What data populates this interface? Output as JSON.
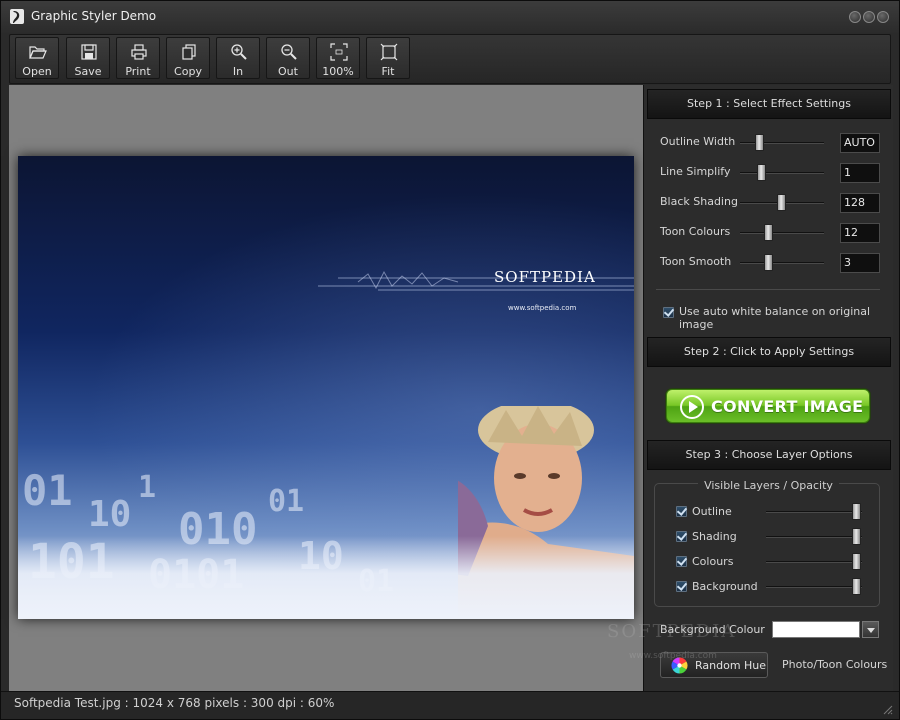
{
  "window": {
    "title": "Graphic Styler Demo"
  },
  "toolbar": {
    "buttons": [
      {
        "label": "Open",
        "icon": "folder-open-icon"
      },
      {
        "label": "Save",
        "icon": "floppy-disk-icon"
      },
      {
        "label": "Print",
        "icon": "printer-icon"
      },
      {
        "label": "Copy",
        "icon": "copy-icon"
      },
      {
        "label": "In",
        "icon": "zoom-in-icon"
      },
      {
        "label": "Out",
        "icon": "zoom-out-icon"
      },
      {
        "label": "100%",
        "icon": "actual-size-icon"
      },
      {
        "label": "Fit",
        "icon": "fit-window-icon"
      }
    ]
  },
  "image": {
    "brand": "SOFTPEDIA",
    "brand_url": "www.softpedia.com"
  },
  "panel": {
    "step1": "Step 1 : Select Effect Settings",
    "settings": [
      {
        "label": "Outline Width",
        "value": "AUTO",
        "level": 0.2
      },
      {
        "label": "Line Simplify",
        "value": "1",
        "level": 0.23
      },
      {
        "label": "Black Shading",
        "value": "128",
        "level": 0.5
      },
      {
        "label": "Toon Colours",
        "value": "12",
        "level": 0.33
      },
      {
        "label": "Toon Smooth",
        "value": "3",
        "level": 0.32
      }
    ],
    "auto_white_balance": {
      "label": "Use auto white balance on original image",
      "checked": true
    },
    "step2": "Step 2 : Click to Apply Settings",
    "convert_label": "CONVERT IMAGE",
    "step3": "Step 3 : Choose Layer Options",
    "layers_title": "Visible Layers / Opacity",
    "layers": [
      {
        "label": "Outline",
        "checked": true,
        "opacity": 1.0
      },
      {
        "label": "Shading",
        "checked": true,
        "opacity": 1.0
      },
      {
        "label": "Colours",
        "checked": true,
        "opacity": 1.0
      },
      {
        "label": "Background",
        "checked": true,
        "opacity": 1.0
      }
    ],
    "background_colour_label": "Background Colour",
    "background_colour_value": "#ffffff",
    "random_hue_label": "Random Hue",
    "photo_toon_label": "Photo/Toon Colours"
  },
  "watermark": {
    "text": "SOFTPEDIA",
    "url": "www.softpedia.com"
  },
  "status": {
    "text": "Softpedia Test.jpg : 1024 x 768 pixels : 300 dpi : 60%"
  },
  "colors": {
    "convert_green": "#6bbe28",
    "panel_bg": "#2c2c2c",
    "viewport_bg": "#808080"
  }
}
